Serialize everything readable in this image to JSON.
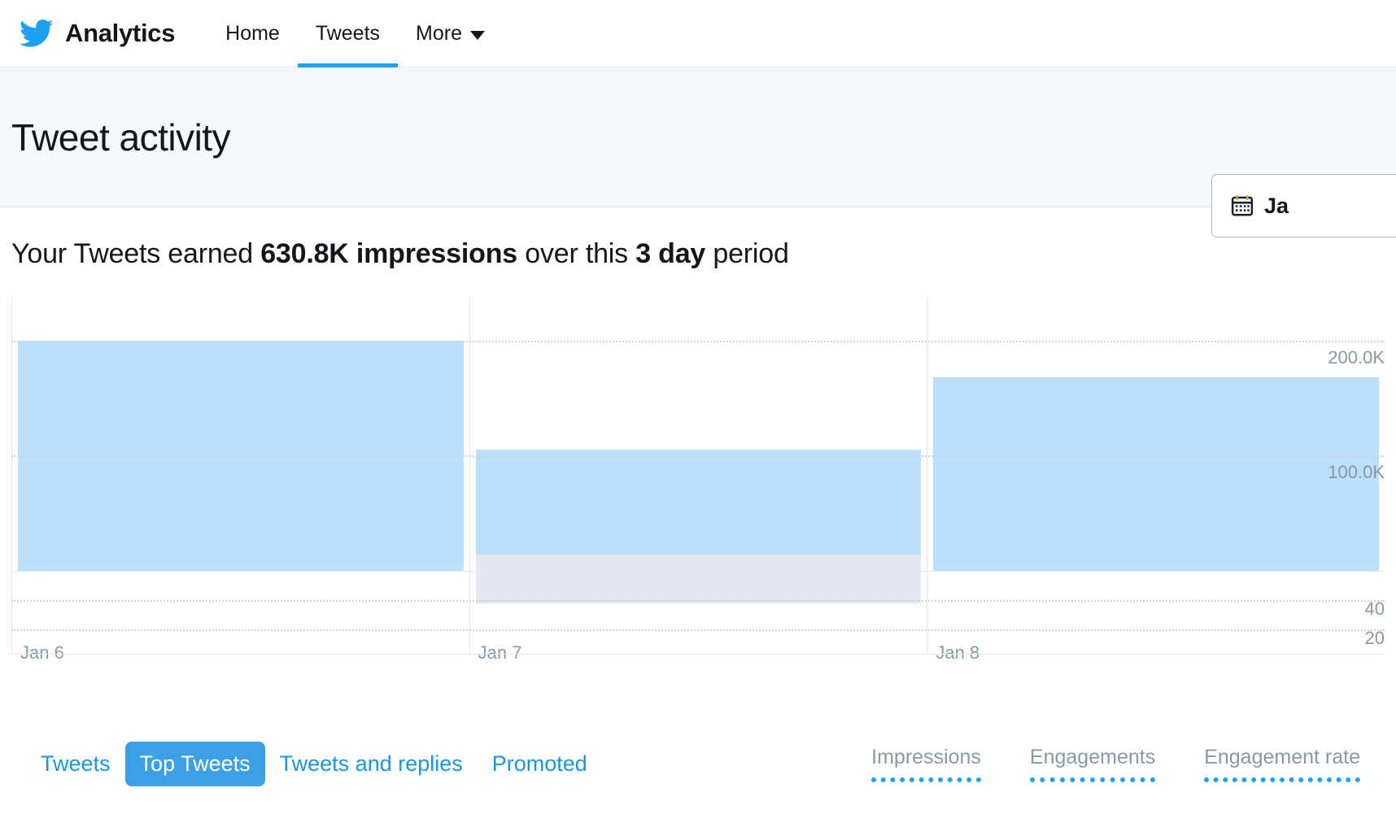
{
  "nav": {
    "logo_icon": "twitter-bird-icon",
    "brand": "Analytics",
    "items": [
      {
        "label": "Home",
        "active": false
      },
      {
        "label": "Tweets",
        "active": true
      },
      {
        "label": "More",
        "active": false,
        "icon": "chevron-down-icon"
      }
    ]
  },
  "header": {
    "title": "Tweet activity",
    "date_picker": {
      "icon": "calendar-icon",
      "label": "Ja"
    }
  },
  "summary": {
    "prefix": "Your Tweets earned ",
    "impressions": "630.8K impressions",
    "middle": " over this ",
    "period": "3 day",
    "suffix": " period"
  },
  "chart_data": {
    "type": "bar",
    "title": "Tweet activity",
    "categories": [
      "Jan 6",
      "Jan 7",
      "Jan 8"
    ],
    "xlabel": "",
    "ylabel": "Impressions",
    "series": [
      {
        "name": "Impressions",
        "color": "#bcdffb",
        "values": [
          200000,
          105000,
          168000
        ]
      },
      {
        "name": "Engagements",
        "color": "#e2e8ed",
        "values": [
          0,
          34,
          0
        ]
      }
    ],
    "y_axis_primary": {
      "ticks": [
        "200.0K",
        "100.0K"
      ],
      "tick_values": [
        200000,
        100000
      ],
      "ylim": [
        0,
        230000
      ]
    },
    "y_axis_secondary": {
      "ticks": [
        "40",
        "20"
      ],
      "tick_values": [
        40,
        20
      ],
      "ylim": [
        0,
        50
      ]
    },
    "grid": true,
    "legend": "bottom-right"
  },
  "filters": {
    "tabs": [
      {
        "label": "Tweets",
        "active": false
      },
      {
        "label": "Top Tweets",
        "active": true
      },
      {
        "label": "Tweets and replies",
        "active": false
      },
      {
        "label": "Promoted",
        "active": false
      }
    ]
  },
  "metrics": [
    {
      "label": "Impressions"
    },
    {
      "label": "Engagements"
    },
    {
      "label": "Engagement rate"
    }
  ],
  "colors": {
    "brand_blue": "#1da1f2",
    "link_blue": "#1b95e0",
    "active_pill": "#3ba0e6",
    "bar_impressions": "#bcdffb",
    "bar_engagements": "#e2e8ed",
    "header_bg": "#f5f8fa",
    "axis_text": "#8899a6"
  }
}
